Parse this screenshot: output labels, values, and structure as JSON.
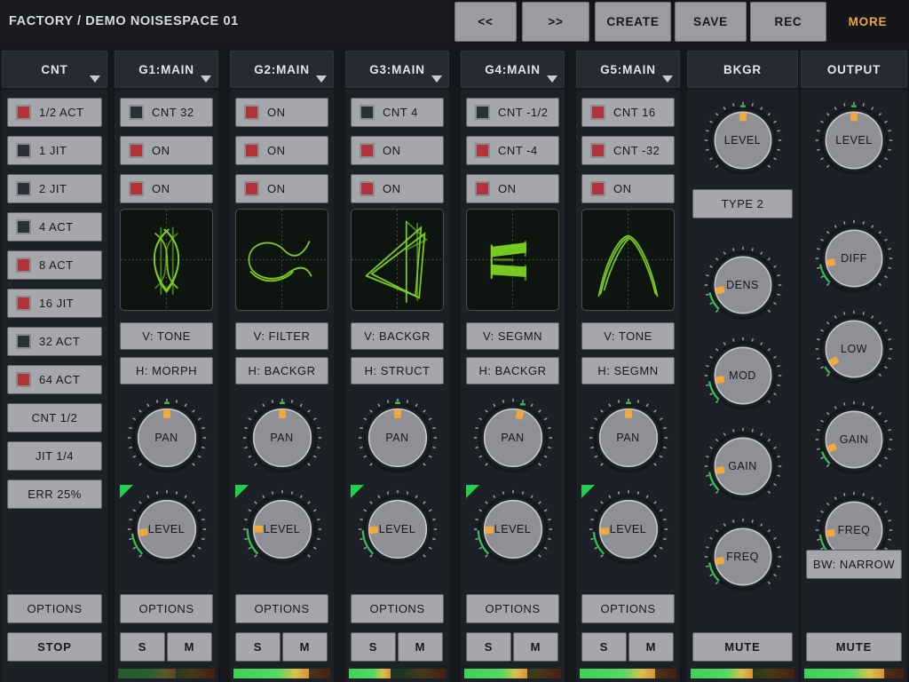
{
  "window": {
    "background": "#15171c"
  },
  "topbar": {
    "preset": "FACTORY / DEMO NOISESPACE 01",
    "buttons": [
      {
        "name": "prev",
        "label": "<<"
      },
      {
        "name": "next",
        "label": ">>"
      },
      {
        "name": "create",
        "label": "CREATE"
      },
      {
        "name": "save",
        "label": "SAVE"
      },
      {
        "name": "rec",
        "label": "REC"
      }
    ],
    "more_label": "MORE",
    "more_color": "#e8a83a"
  },
  "colors": {
    "accent_orange": "#e8a83a",
    "knob_indicator": "#f0a93c",
    "arc_green": "#2fbf55",
    "led_on": "#b4333a",
    "led_off": "#2b2f38",
    "button_face": "#a5a7ab",
    "panel": "#1d2026",
    "header": "#262a33",
    "scope_trace": "#7ed321"
  },
  "columns": [
    {
      "id": "cnt",
      "header": "CNT",
      "has_caret": true,
      "type": "counter",
      "toggles": [
        {
          "label": "1/2 ACT",
          "on": true
        },
        {
          "label": "1 JIT",
          "on": false
        },
        {
          "label": "2 JIT",
          "on": false
        },
        {
          "label": "4 ACT",
          "on": false
        },
        {
          "label": "8 ACT",
          "on": true
        },
        {
          "label": "16 JIT",
          "on": true
        },
        {
          "label": "32 ACT",
          "on": false
        },
        {
          "label": "64 ACT",
          "on": true
        }
      ],
      "value_buttons": [
        "CNT 1/2",
        "JIT 1/4",
        "ERR 25%"
      ],
      "options_label": "OPTIONS",
      "transport_label": "STOP"
    },
    {
      "id": "g1",
      "header": "G1:MAIN",
      "has_caret": true,
      "type": "generator",
      "toggles": [
        {
          "label": "CNT 32",
          "on": false
        },
        {
          "label": "ON",
          "on": true
        },
        {
          "label": "ON",
          "on": true
        }
      ],
      "scope": "lissajous-figure8",
      "v_label": "V: TONE",
      "h_label": "H: MORPH",
      "knobs": [
        {
          "label": "PAN",
          "value": 0.5,
          "arc": false,
          "corner": false
        },
        {
          "label": "LEVEL",
          "value": 0.14,
          "arc": true,
          "corner": true
        }
      ],
      "options_label": "OPTIONS",
      "solo_label": "S",
      "mute_label": "M",
      "meter": {
        "level": 0.6,
        "dim": true
      }
    },
    {
      "id": "g2",
      "header": "G2:MAIN",
      "has_caret": true,
      "type": "generator",
      "toggles": [
        {
          "label": "ON",
          "on": true
        },
        {
          "label": "ON",
          "on": true
        },
        {
          "label": "ON",
          "on": true
        }
      ],
      "scope": "s-curve",
      "v_label": "V: FILTER",
      "h_label": "H: BACKGR",
      "knobs": [
        {
          "label": "PAN",
          "value": 0.5,
          "arc": false,
          "corner": false
        },
        {
          "label": "LEVEL",
          "value": 0.17,
          "arc": true,
          "corner": true
        }
      ],
      "options_label": "OPTIONS",
      "solo_label": "S",
      "mute_label": "M",
      "meter": {
        "level": 0.78,
        "dim": false
      }
    },
    {
      "id": "g3",
      "header": "G3:MAIN",
      "has_caret": true,
      "type": "generator",
      "toggles": [
        {
          "label": "CNT 4",
          "on": false
        },
        {
          "label": "ON",
          "on": true
        },
        {
          "label": "ON",
          "on": true
        }
      ],
      "scope": "angular",
      "v_label": "V: BACKGR",
      "h_label": "H: STRUCT",
      "knobs": [
        {
          "label": "PAN",
          "value": 0.5,
          "arc": false,
          "corner": false
        },
        {
          "label": "LEVEL",
          "value": 0.16,
          "arc": true,
          "corner": true
        }
      ],
      "options_label": "OPTIONS",
      "solo_label": "S",
      "mute_label": "M",
      "meter": {
        "level": 0.43,
        "dim": false
      }
    },
    {
      "id": "g4",
      "header": "G4:MAIN",
      "has_caret": true,
      "type": "generator",
      "toggles": [
        {
          "label": "CNT -1/2",
          "on": false
        },
        {
          "label": "CNT -4",
          "on": true
        },
        {
          "label": "ON",
          "on": true
        }
      ],
      "scope": "dense-e",
      "v_label": "V: SEGMN",
      "h_label": "H: BACKGR",
      "knobs": [
        {
          "label": "PAN",
          "value": 0.56,
          "arc": false,
          "corner": false
        },
        {
          "label": "LEVEL",
          "value": 0.16,
          "arc": true,
          "corner": true
        }
      ],
      "options_label": "OPTIONS",
      "solo_label": "S",
      "mute_label": "M",
      "meter": {
        "level": 0.65,
        "dim": false
      }
    },
    {
      "id": "g5",
      "header": "G5:MAIN",
      "has_caret": true,
      "type": "generator",
      "toggles": [
        {
          "label": "CNT 16",
          "on": true
        },
        {
          "label": "CNT -32",
          "on": true
        },
        {
          "label": "ON",
          "on": true
        }
      ],
      "scope": "arch",
      "v_label": "V: TONE",
      "h_label": "H: SEGMN",
      "knobs": [
        {
          "label": "PAN",
          "value": 0.5,
          "arc": false,
          "corner": false
        },
        {
          "label": "LEVEL",
          "value": 0.15,
          "arc": true,
          "corner": true
        }
      ],
      "options_label": "OPTIONS",
      "solo_label": "S",
      "mute_label": "M",
      "meter": {
        "level": 0.78,
        "dim": false
      }
    },
    {
      "id": "bkgr",
      "header": "BKGR",
      "has_caret": false,
      "type": "background",
      "knobs": [
        {
          "label": "LEVEL",
          "value": 0.5,
          "arc": false
        },
        {
          "label": "DENS",
          "value": 0.12,
          "arc": true
        },
        {
          "label": "MOD",
          "value": 0.13,
          "arc": true
        },
        {
          "label": "GAIN",
          "value": 0.13,
          "arc": true
        },
        {
          "label": "FREQ",
          "value": 0.13,
          "arc": true
        }
      ],
      "type_label": "TYPE 2",
      "mute_label": "MUTE",
      "meter": {
        "level": 0.6,
        "dim": false
      }
    },
    {
      "id": "output",
      "header": "OUTPUT",
      "has_caret": false,
      "type": "output",
      "knobs": [
        {
          "label": "LEVEL",
          "value": 0.5,
          "arc": false
        },
        {
          "label": "DIFF",
          "value": 0.13,
          "arc": true
        },
        {
          "label": "LOW",
          "value": 0.05,
          "arc": true
        },
        {
          "label": "GAIN",
          "value": 0.09,
          "arc": true
        },
        {
          "label": "FREQ",
          "value": 0.14,
          "arc": true
        }
      ],
      "bw_label": "BW: NARROW",
      "mute_label": "MUTE",
      "meter": {
        "level": 0.8,
        "dim": false
      }
    }
  ]
}
